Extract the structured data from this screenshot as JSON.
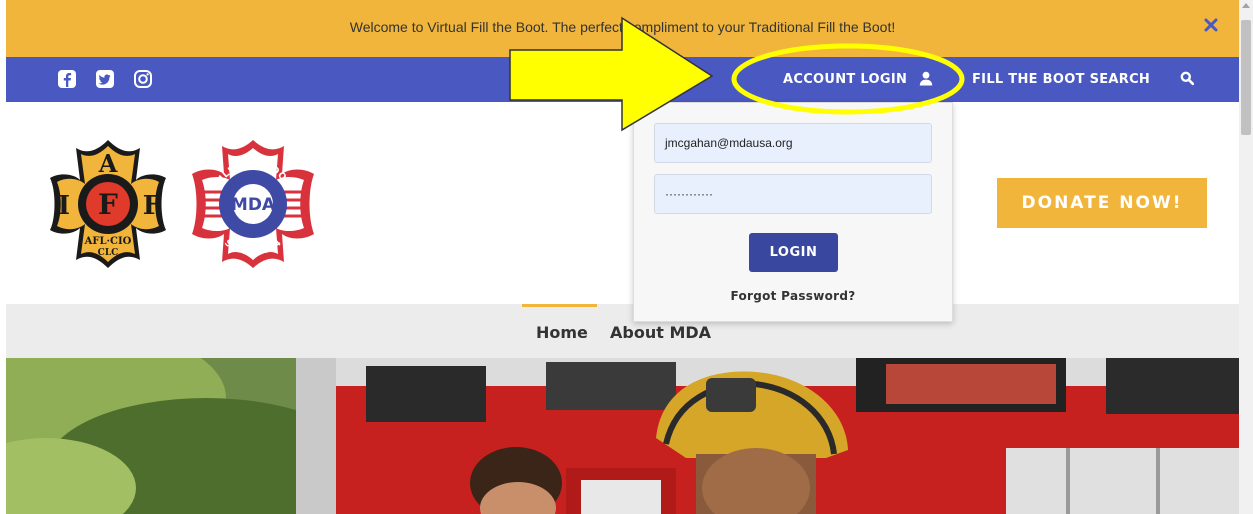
{
  "banner": {
    "text": "Welcome to Virtual Fill the Boot.  The perfect compliment to your Traditional Fill the Boot!",
    "close_icon": "close-icon"
  },
  "navbar": {
    "social_icons": [
      "facebook-icon",
      "twitter-icon",
      "instagram-icon"
    ],
    "account_login_label": "ACCOUNT LOGIN",
    "account_login_icon": "user-icon",
    "search_label": "FILL THE BOOT SEARCH",
    "search_icon": "search-icon"
  },
  "header": {
    "logo_left": {
      "letters": [
        "A",
        "I",
        "F",
        "F"
      ],
      "bottom_text": [
        "AFL·CIO",
        "CLC"
      ]
    },
    "logo_right": {
      "top_text": "FILL THE BOOT",
      "center_text": "MDA",
      "bottom_text": "SINCE 1954"
    },
    "donate_label": "DONATE NOW!"
  },
  "login_form": {
    "email_value": "jmcgahan@mdausa.org",
    "password_value": "············",
    "login_label": "LOGIN",
    "forgot_label": "Forgot Password?"
  },
  "subnav": {
    "items": [
      {
        "label": "Home",
        "active": true
      },
      {
        "label": "About MDA",
        "active": false
      }
    ]
  },
  "colors": {
    "banner": "#f0b53a",
    "navbar": "#4a59c1",
    "login_button": "#3a479e",
    "annotation": "#ffff00"
  }
}
